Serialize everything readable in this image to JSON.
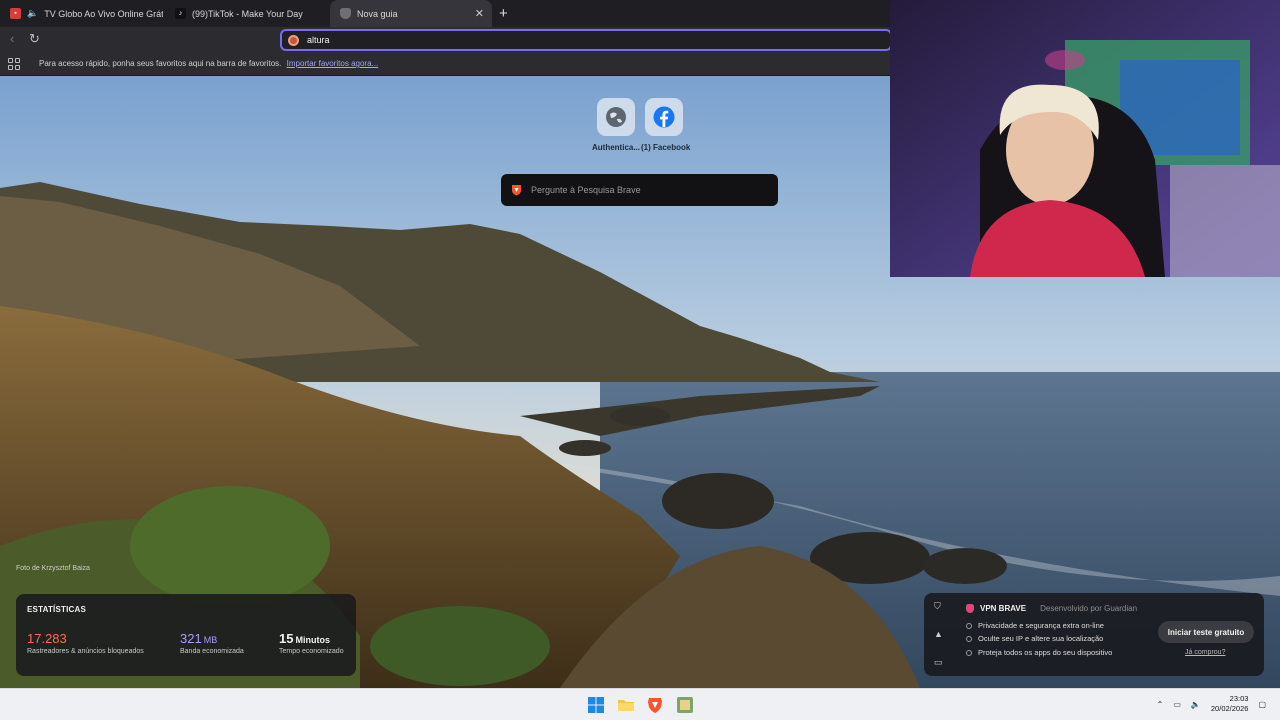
{
  "tabs": [
    {
      "label": "TV Globo Ao Vivo Online Grátis |",
      "icon": "tv-icon",
      "color": "#d93a3a"
    },
    {
      "label": "(99)TikTok - Make Your Day",
      "icon": "tiktok-icon",
      "color": "#111111"
    },
    {
      "label": "Nova guia",
      "icon": "brave-shield-icon",
      "active": true
    }
  ],
  "omnibox": {
    "value": "altura "
  },
  "bookmarks_bar": {
    "text": "Para acesso rápido, ponha seus favoritos aqui na barra de favoritos.",
    "link": "Importar favoritos agora..."
  },
  "top_sites": [
    {
      "label": "Authentica...",
      "icon": "globe-icon"
    },
    {
      "label": "(1) Facebook",
      "icon": "facebook-icon"
    }
  ],
  "search": {
    "placeholder": "Pergunte à Pesquisa Brave"
  },
  "photo_credit": "Foto de Krzysztof Baiza",
  "stats": {
    "title": "ESTATÍSTICAS",
    "items": [
      {
        "value": "17.283",
        "unit": "",
        "label": "Rastreadores & anúncios bloqueados",
        "color": "#ff6b57"
      },
      {
        "value": "321",
        "unit": "MB",
        "label": "Banda economizada",
        "color": "#a99cff"
      },
      {
        "value": "15",
        "unit": "Minutos",
        "label": "Tempo economizado",
        "color": "#f2f2f2"
      }
    ]
  },
  "vpn": {
    "title": "VPN BRAVE",
    "subtitle": "Desenvolvido por Guardian",
    "features": [
      "Privacidade e segurança extra on-line",
      "Oculte seu IP e altere sua localização",
      "Proteja todos os apps do seu dispositivo"
    ],
    "cta": "Iniciar teste gratuito",
    "already": "Já comprou?"
  },
  "clock": {
    "time": "23:03",
    "date": "20/02/2026"
  }
}
